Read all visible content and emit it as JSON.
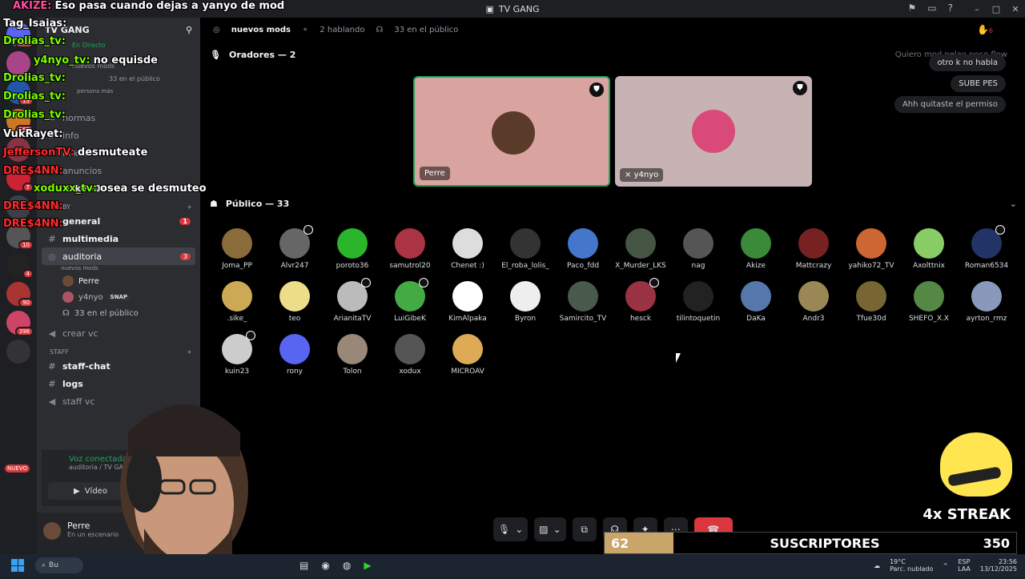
{
  "window": {
    "title": "TV GANG",
    "hand_count": "6"
  },
  "server": {
    "name": "TV GANG"
  },
  "sidebar": {
    "live_label": "En Directo",
    "popup": {
      "channel": "nuevos mods",
      "sub": "33 en el público",
      "more": "persona más"
    },
    "channels": [
      {
        "name": "normas"
      },
      {
        "name": "info"
      },
      {
        "name": "ticket"
      },
      {
        "name": "anuncios"
      },
      {
        "name": "ticket-0184",
        "badge": "NUEVO"
      }
    ],
    "category_lobby": "LOBBY",
    "lobby_channels": [
      {
        "name": "general",
        "badge": "1"
      },
      {
        "name": "multimedia"
      },
      {
        "name": "auditoria",
        "badge": "3",
        "sub": "nuevos mods"
      }
    ],
    "voice_users": [
      {
        "name": "Perre"
      },
      {
        "name": "y4nyo",
        "tag": "SNAP"
      },
      {
        "name": "33 en el público"
      }
    ],
    "create_vc": "crear vc",
    "category_staff": "STAFF",
    "staff_channels": [
      {
        "name": "staff-chat"
      },
      {
        "name": "logs"
      },
      {
        "name": "staff vc"
      }
    ]
  },
  "voice_panel": {
    "status": "Voz conectada",
    "sub": "auditoria / TV GANG",
    "video_label": "Vídeo"
  },
  "user_panel": {
    "name": "Perre",
    "status": "En un escenario"
  },
  "stage": {
    "header": {
      "name": "nuevos mods",
      "talking": "2 hablando",
      "audience": "33 en el público"
    },
    "speakers_title": "Oradores — 2",
    "speakers": [
      {
        "name": "Perre",
        "bg": "#d9a3a0",
        "face": "#5a3b2a"
      },
      {
        "name": "y4nyo",
        "bg": "#c7b3b3",
        "face": "#d94a7a"
      }
    ],
    "audience_title": "Público — 33",
    "audience": [
      {
        "name": "Joma_PP",
        "c": "#8a6b3a"
      },
      {
        "name": "Alvr247",
        "c": "#666",
        "badge": true
      },
      {
        "name": "poroto36",
        "c": "#2bb52b"
      },
      {
        "name": "samutrol20",
        "c": "#aa3344"
      },
      {
        "name": "Chenet :)",
        "c": "#ddd"
      },
      {
        "name": "El_roba_lolis_",
        "c": "#333"
      },
      {
        "name": "Paco_fdd",
        "c": "#4477cc"
      },
      {
        "name": "X_Murder_LKS",
        "c": "#445544"
      },
      {
        "name": "nag",
        "c": "#555"
      },
      {
        "name": "Akize",
        "c": "#3a8a3a"
      },
      {
        "name": "Mattcrazy",
        "c": "#772222"
      },
      {
        "name": "yahiko72_TV",
        "c": "#cc6633"
      },
      {
        "name": "Axolttnix",
        "c": "#88cc66"
      },
      {
        "name": "Roman6534",
        "c": "#223366",
        "badge": true
      },
      {
        "name": ".sike_",
        "c": "#ccaa55"
      },
      {
        "name": "teo",
        "c": "#eedd88"
      },
      {
        "name": "ArianitaTV",
        "c": "#bbb",
        "badge": true
      },
      {
        "name": "LuiGibeK",
        "c": "#44aa44",
        "badge": true
      },
      {
        "name": "KimAlpaka",
        "c": "#fff"
      },
      {
        "name": "Byron",
        "c": "#eee"
      },
      {
        "name": "Samircito_TV",
        "c": "#4a5a4a"
      },
      {
        "name": "hesck",
        "c": "#993344",
        "badge": true
      },
      {
        "name": "tilintoquetin",
        "c": "#222"
      },
      {
        "name": "DaKa",
        "c": "#5577aa"
      },
      {
        "name": "Andr3",
        "c": "#998855"
      },
      {
        "name": "Tfue30d",
        "c": "#776633"
      },
      {
        "name": "SHEFO_X.X",
        "c": "#558844"
      },
      {
        "name": "ayrton_rmz",
        "c": "#8899bb"
      },
      {
        "name": "kuin23",
        "c": "#ccc",
        "badge": true
      },
      {
        "name": "rony",
        "c": "#5865f2"
      },
      {
        "name": "Tolon",
        "c": "#998877"
      },
      {
        "name": "xodux",
        "c": "#555"
      },
      {
        "name": "MICROAV",
        "c": "#ddaa55"
      }
    ],
    "chat": [
      {
        "text": "Quiero mod pelao poco flow"
      },
      {
        "text": "otro k no habla"
      },
      {
        "text": "SUBE PES"
      },
      {
        "text": "Ahh quitaste el permiso"
      }
    ]
  },
  "overlay_chat": [
    {
      "user": "AKIZE:",
      "msg": "Eso pasa cuando dejas a yanyo de mod"
    },
    {
      "user": "Tag_Isaias:",
      "msg": ""
    },
    {
      "user": "Drolias_tv:",
      "msg": ""
    },
    {
      "user": "y4nyo_tv:",
      "msg": "no equisde"
    },
    {
      "user": "Drolias_tv:",
      "msg": ""
    },
    {
      "user": "Drolias_tv:",
      "msg": ""
    },
    {
      "user": "Drolias_tv:",
      "msg": ""
    },
    {
      "user": "VukRayet:",
      "msg": ""
    },
    {
      "user": "JeffersonTV:",
      "msg": "desmuteate"
    },
    {
      "user": "DRE$4NN:",
      "msg": ""
    },
    {
      "user": "xoduxx_tv:",
      "msg": "osea se desmuteo"
    },
    {
      "user": "DRE$4NN:",
      "msg": ""
    },
    {
      "user": "DRE$4NN:",
      "msg": ""
    }
  ],
  "streak": {
    "label": "4x STREAK"
  },
  "subs_bar": {
    "current": "62",
    "label": "SUSCRIPTORES",
    "goal": "350"
  },
  "guild_badges": [
    "211",
    "19",
    "161",
    "7",
    "10",
    "4",
    "90",
    "398",
    "NUEVO"
  ],
  "taskbar": {
    "search": "Bu",
    "weather_temp": "19°C",
    "weather_text": "Parc. nublado",
    "lang1": "ESP",
    "lang2": "LAA",
    "time": "23:56",
    "date": "13/12/2025"
  }
}
